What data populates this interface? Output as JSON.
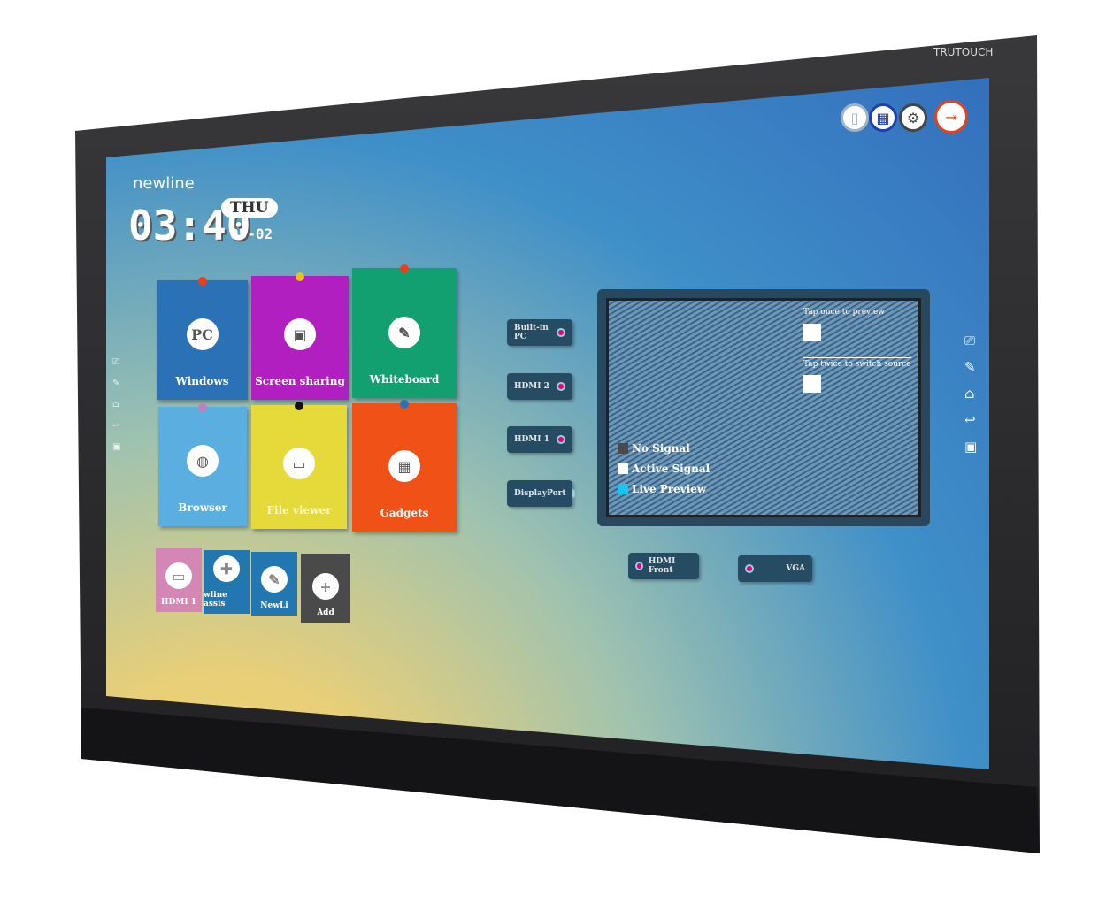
{
  "device": {
    "brand_label": "TRUTOUCH"
  },
  "home": {
    "logo": "newline",
    "time": "03:40",
    "day": "THU",
    "date": "05-02"
  },
  "top_icons": [
    {
      "icon": "usb-icon",
      "color": "#9fb3c8"
    },
    {
      "icon": "network-icon",
      "color": "#1e3fb0"
    },
    {
      "icon": "gear-icon",
      "color": "#444444"
    },
    {
      "icon": "exit-icon",
      "color": "#e8401c"
    }
  ],
  "tiles": [
    {
      "label": "Windows",
      "icon": "pc-icon",
      "glyph": "PC",
      "color": "#2a72b5"
    },
    {
      "label": "Screen sharing",
      "icon": "screen-share-icon",
      "glyph": "▣",
      "color": "#b21fc0"
    },
    {
      "label": "Whiteboard",
      "icon": "pen-icon",
      "glyph": "✎",
      "color": "#12a070"
    },
    {
      "label": "Browser",
      "icon": "globe-icon",
      "glyph": "◍",
      "color": "#5aaee0"
    },
    {
      "label": "File viewer",
      "icon": "folder-icon",
      "glyph": "▭",
      "color": "#e6d93a"
    },
    {
      "label": "Gadgets",
      "icon": "grid-icon",
      "glyph": "▦",
      "color": "#ef5117"
    }
  ],
  "shortcuts": [
    {
      "label": "HDMI 1",
      "icon": "hdmi-icon",
      "glyph": "▭",
      "color": "#d486b4"
    },
    {
      "label": "wline assis",
      "icon": "newline-assistant-icon",
      "glyph": "✚",
      "color": "#2277b0"
    },
    {
      "label": "NewLi",
      "icon": "newline-app-icon",
      "glyph": "✎",
      "color": "#2277b0"
    },
    {
      "label": "Add",
      "icon": "plus-icon",
      "glyph": "+",
      "color": "#4a4a4a"
    }
  ],
  "sources": [
    "Built-in PC",
    "HDMI 2",
    "HDMI 1",
    "DisplayPort",
    "HDMI Front",
    "VGA"
  ],
  "preview": {
    "hint_once": "Tap once to preview",
    "hint_twice": "Tap twice to switch source",
    "legend": [
      {
        "label": "No Signal",
        "color": "#4a4a4a"
      },
      {
        "label": "Active Signal",
        "color": "#ffffff"
      },
      {
        "label": "Live Preview",
        "color": "#16c8ee"
      }
    ]
  },
  "sidebar_icons": [
    "annotate-icon",
    "pen-icon",
    "home-icon",
    "back-icon",
    "source-icon"
  ]
}
